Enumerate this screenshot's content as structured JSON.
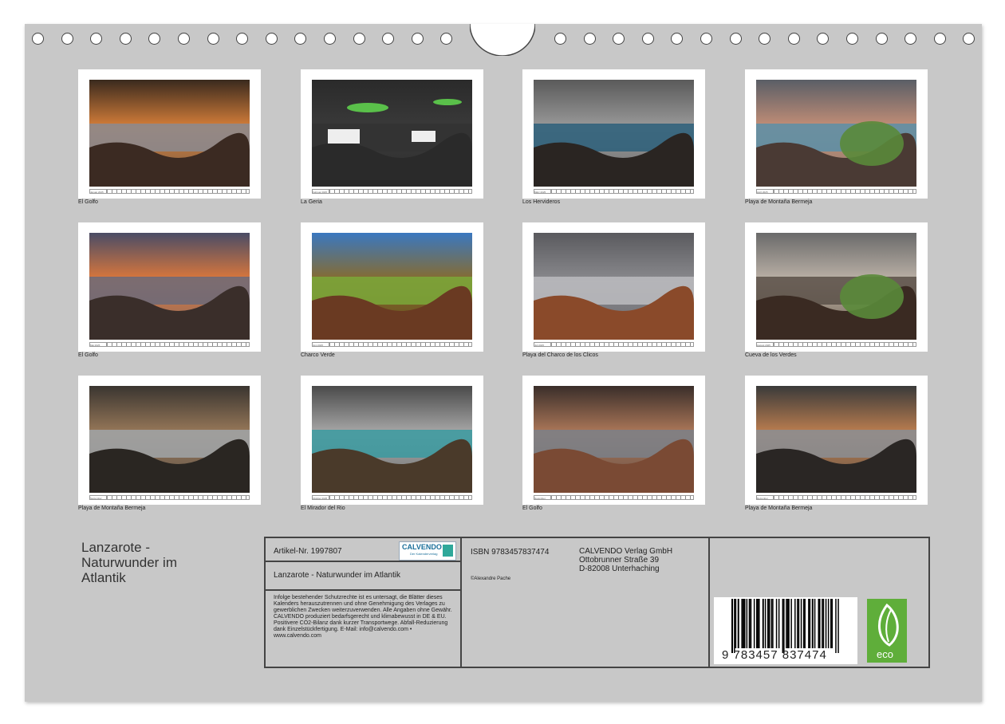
{
  "photos": [
    {
      "caption": "El Golfo",
      "month": "Januar 2025"
    },
    {
      "caption": "La Geria",
      "month": "Februar 2025"
    },
    {
      "caption": "Los Hervideros",
      "month": "März 2025"
    },
    {
      "caption": "Playa de Montaña Bermeja",
      "month": "April 2025"
    },
    {
      "caption": "El Golfo",
      "month": "Mai 2025"
    },
    {
      "caption": "Charco Verde",
      "month": "Juni 2025"
    },
    {
      "caption": "Playa del Charco de los Clicos",
      "month": "Juli 2025"
    },
    {
      "caption": "Cueva de los Verdes",
      "month": "August 2025"
    },
    {
      "caption": "Playa de Montaña Bermeja",
      "month": "September 2025"
    },
    {
      "caption": "El Mirador del Rio",
      "month": "Oktober 2025"
    },
    {
      "caption": "El Golfo",
      "month": "November 2025"
    },
    {
      "caption": "Playa de Montaña Bermeja",
      "month": "Dezember 2025"
    }
  ],
  "title": {
    "line1": "Lanzarote -",
    "line2": "Naturwunder im",
    "line3": "Atlantik"
  },
  "info": {
    "article": "Artikel-Nr. 1997807",
    "calvendo_logo": "CALVENDO",
    "calvendo_tagline": "Der Kalenderverlag",
    "calendar_title": "Lanzarote - Naturwunder im Atlantik",
    "legal": "Infolge bestehender Schutzrechte ist es untersagt, die Blätter dieses Kalenders herauszutrennen und ohne Genehmigung des Verlages zu gewerblichen Zwecken weiterzuverwenden. Alle Angaben ohne Gewähr. CALVENDO produziert bedarfsgerecht und klimabewusst in DE & EU. Positivere CO2-Bilanz dank kurzer Transportwege. Abfall-Reduzierung dank Einzelstückfertigung. E-Mail: info@calvendo.com • www.calvendo.com",
    "isbn": "ISBN 9783457837474",
    "copyright": "©Alexandre Pache",
    "publisher_line1": "CALVENDO Verlag GmbH",
    "publisher_line2": "Ottobrunner Straße 39",
    "publisher_line3": "D-82008 Unterhaching",
    "barcode_text": "9 783457 837474",
    "eco_label": "eco"
  },
  "colors": {
    "sheet": "#c8c8c8",
    "eco_green": "#5fae3a",
    "border": "#444444"
  }
}
